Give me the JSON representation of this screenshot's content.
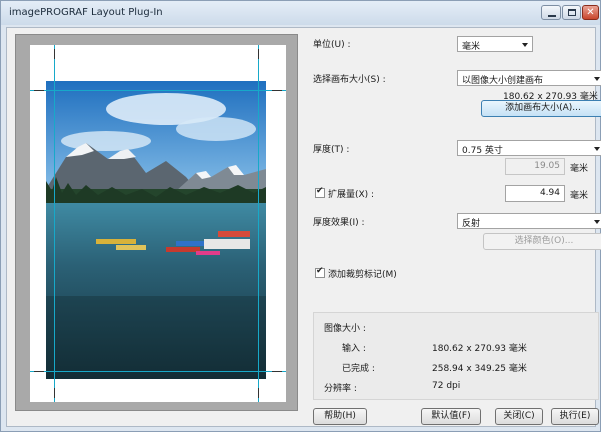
{
  "window": {
    "title": "imagePROGRAF Layout Plug-In"
  },
  "settings": {
    "unit_label": "单位(U) :",
    "unit_value": "毫米",
    "canvas_label": "选择画布大小(S) :",
    "canvas_value": "以图像大小创建画布",
    "canvas_size": "180.62 x 270.93 毫米",
    "add_canvas_button": "添加画布大小(A)...",
    "thickness_label": "厚度(T) :",
    "thickness_value": "0.75 英寸",
    "thickness_mm": "19.05",
    "thickness_unit": "毫米",
    "expand_label": "扩展量(X) :",
    "expand_checked": true,
    "expand_value": "4.94",
    "expand_unit": "毫米",
    "effect_label": "厚度效果(I) :",
    "effect_value": "反射",
    "select_color_button": "选择颜色(O)...",
    "crop_marks_label": "添加裁剪标记(M)",
    "crop_marks_checked": true
  },
  "image_info": {
    "title": "图像大小 :",
    "input_label": "输入 :",
    "input_value": "180.62 x 270.93 毫米",
    "done_label": "已完成 :",
    "done_value": "258.94 x 349.25 毫米",
    "resolution_label": "分辨率 :",
    "resolution_value": "72 dpi"
  },
  "footer": {
    "help_button": "帮助(H)",
    "defaults_button": "默认值(F)",
    "close_button": "关闭(C)",
    "run_button": "执行(E)"
  },
  "icons": {
    "minimize": "minimize-icon",
    "maximize": "maximize-icon",
    "close": "close-icon",
    "dropdown": "chevron-down-icon",
    "checkbox": "checkmark-icon"
  },
  "colors": {
    "guide": "#17a9c9",
    "sky": "#2c7fc7",
    "lake": "#1f4a5e"
  }
}
